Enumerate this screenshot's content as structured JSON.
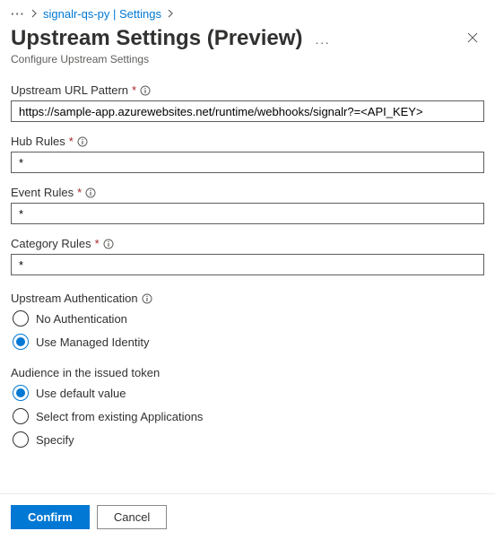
{
  "breadcrumb": {
    "link": "signalr-qs-py | Settings"
  },
  "header": {
    "title": "Upstream Settings (Preview)",
    "subtitle": "Configure Upstream Settings"
  },
  "fields": {
    "url": {
      "label": "Upstream URL Pattern",
      "value": "https://sample-app.azurewebsites.net/runtime/webhooks/signalr?=<API_KEY>"
    },
    "hub": {
      "label": "Hub Rules",
      "value": "*"
    },
    "event": {
      "label": "Event Rules",
      "value": "*"
    },
    "category": {
      "label": "Category Rules",
      "value": "*"
    }
  },
  "auth": {
    "label": "Upstream Authentication",
    "options": {
      "none": "No Authentication",
      "managed": "Use Managed Identity"
    },
    "selected": "managed"
  },
  "audience": {
    "label": "Audience in the issued token",
    "options": {
      "default": "Use default value",
      "existing": "Select from existing Applications",
      "specify": "Specify"
    },
    "selected": "default"
  },
  "footer": {
    "confirm": "Confirm",
    "cancel": "Cancel"
  }
}
